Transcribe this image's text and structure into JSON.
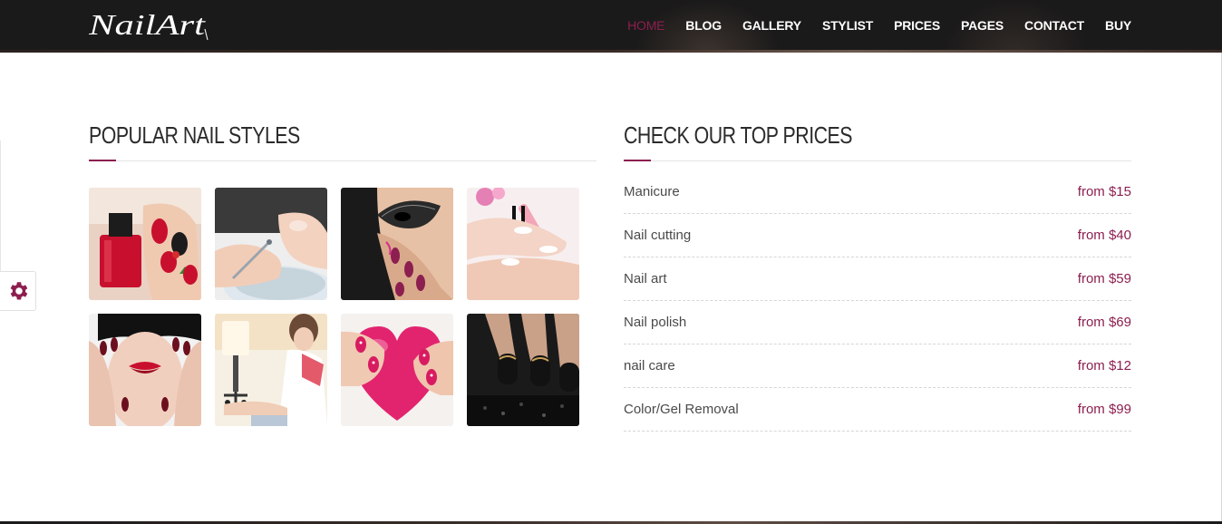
{
  "brand": {
    "logo_text": "NailArt"
  },
  "nav": {
    "items": [
      {
        "label": "HOME",
        "active": true
      },
      {
        "label": "BLOG"
      },
      {
        "label": "GALLERY"
      },
      {
        "label": "STYLIST"
      },
      {
        "label": "PRICES"
      },
      {
        "label": "PAGES"
      },
      {
        "label": "CONTACT"
      },
      {
        "label": "BUY"
      }
    ]
  },
  "styles_section": {
    "title": "POPULAR NAIL STYLES",
    "images": [
      {
        "icon": "red-polish-nails-image"
      },
      {
        "icon": "cuticle-care-image"
      },
      {
        "icon": "masquerade-nails-image"
      },
      {
        "icon": "nail-filing-image"
      },
      {
        "icon": "red-lips-nails-image"
      },
      {
        "icon": "pedicure-image"
      },
      {
        "icon": "heart-nail-art-image"
      },
      {
        "icon": "black-matte-nails-image"
      }
    ]
  },
  "prices_section": {
    "title": "CHECK OUR TOP PRICES",
    "items": [
      {
        "name": "Manicure",
        "price": "from $15"
      },
      {
        "name": "Nail cutting",
        "price": "from $40"
      },
      {
        "name": "Nail art",
        "price": "from $59"
      },
      {
        "name": "Nail polish",
        "price": "from $69"
      },
      {
        "name": "nail care",
        "price": "from $12"
      },
      {
        "name": "Color/Gel Removal",
        "price": "from $99"
      }
    ]
  },
  "settings": {
    "icon": "gear-icon"
  },
  "colors": {
    "accent": "#8c1f4f",
    "header_bg": "#1b1a1a",
    "text": "#4a4a4a"
  }
}
